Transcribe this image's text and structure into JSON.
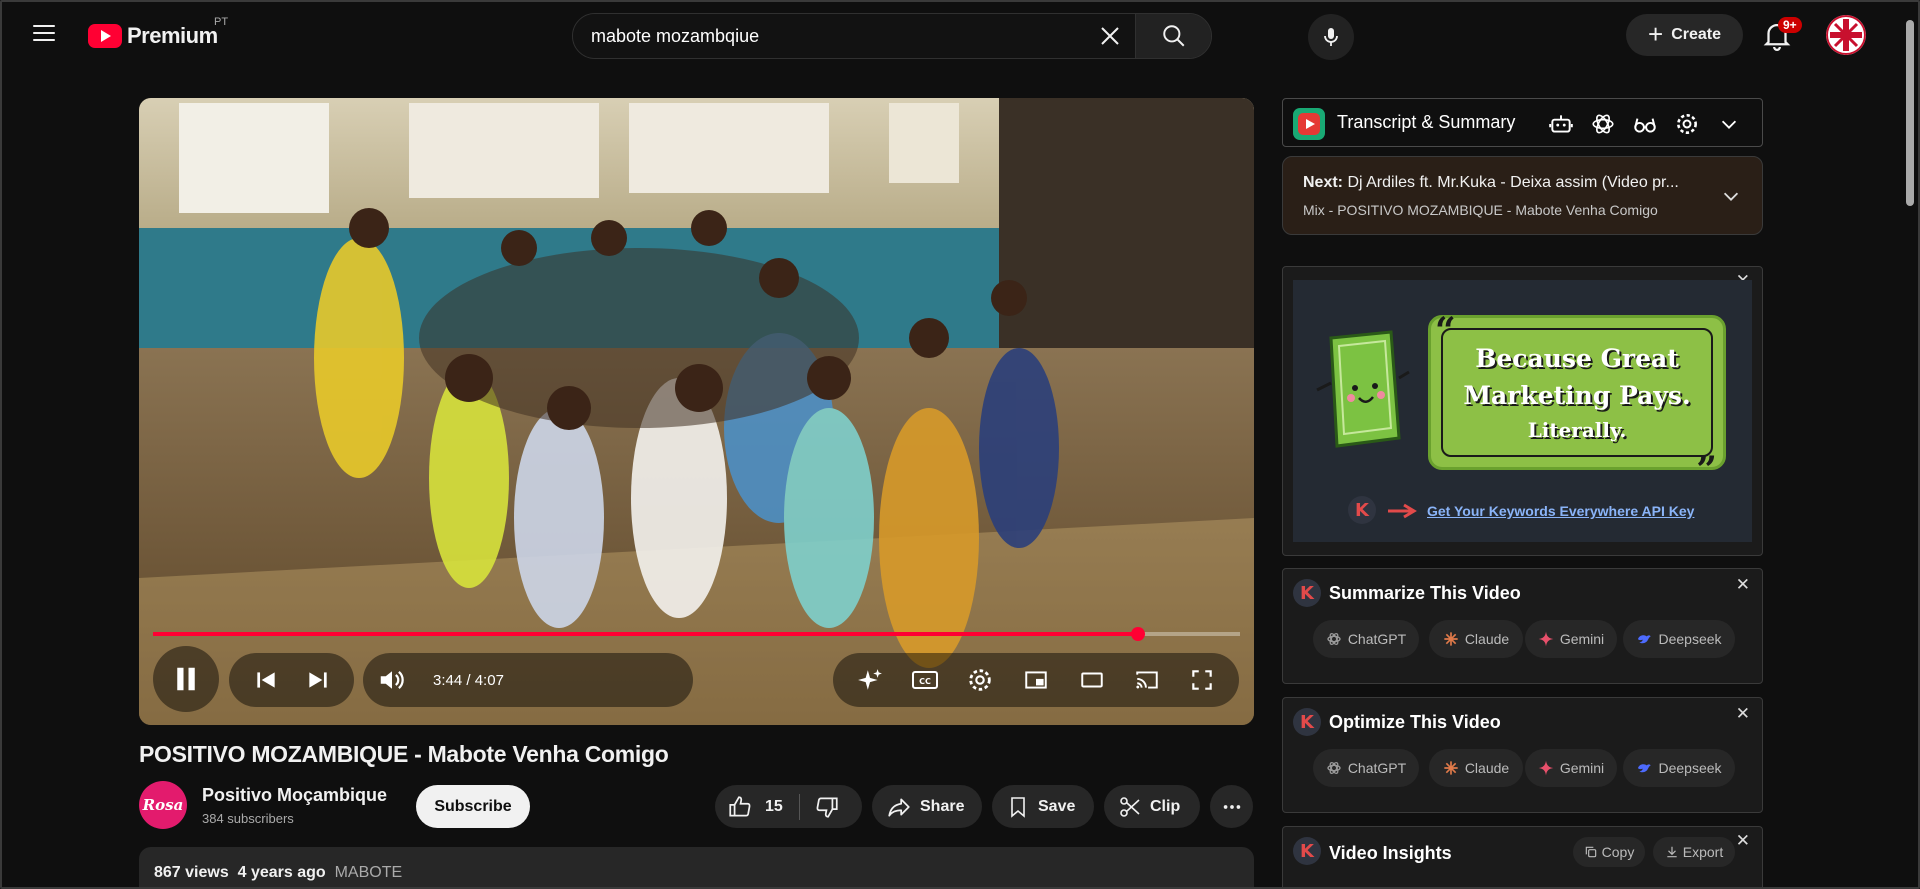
{
  "header": {
    "logo_text": "Premium",
    "logo_country": "PT",
    "search_value": "mabote mozambqiue",
    "create_label": "Create",
    "notification_count": "9+"
  },
  "player": {
    "current_time": "3:44",
    "duration": "4:07",
    "time_separator": " / ",
    "progress_fraction": 0.906,
    "state": "playing"
  },
  "video": {
    "title": "POSITIVO MOZAMBIQUE - Mabote Venha Comigo",
    "channel_name": "Positivo Moçambique",
    "channel_avatar_text": "Rosa",
    "subscribers": "384 subscribers",
    "subscribe_label": "Subscribe",
    "likes": "15",
    "share_label": "Share",
    "save_label": "Save",
    "clip_label": "Clip",
    "views": "867 views",
    "age": "4 years ago",
    "tag": "MABOTE"
  },
  "transcript_bar": {
    "title": "Transcript & Summary"
  },
  "next_up": {
    "prefix": "Next:",
    "title": " Dj Ardiles ft. Mr.Kuka - Deixa assim (Video pr...",
    "mix": "Mix - POSITIVO MOZAMBIQUE - Mabote Venha Comigo"
  },
  "ad": {
    "line1": "Because Great",
    "line2": "Marketing Pays.",
    "line3": "Literally.",
    "link": "Get Your Keywords Everywhere API Key"
  },
  "summarize": {
    "title": "Summarize This Video",
    "buttons": [
      "ChatGPT",
      "Claude",
      "Gemini",
      "Deepseek"
    ]
  },
  "optimize": {
    "title": "Optimize This Video",
    "buttons": [
      "ChatGPT",
      "Claude",
      "Gemini",
      "Deepseek"
    ]
  },
  "insights": {
    "title": "Video Insights",
    "copy_label": "Copy",
    "export_label": "Export"
  },
  "colors": {
    "accent": "#ff0033",
    "background": "#0f0f0f",
    "surface": "#272727"
  }
}
